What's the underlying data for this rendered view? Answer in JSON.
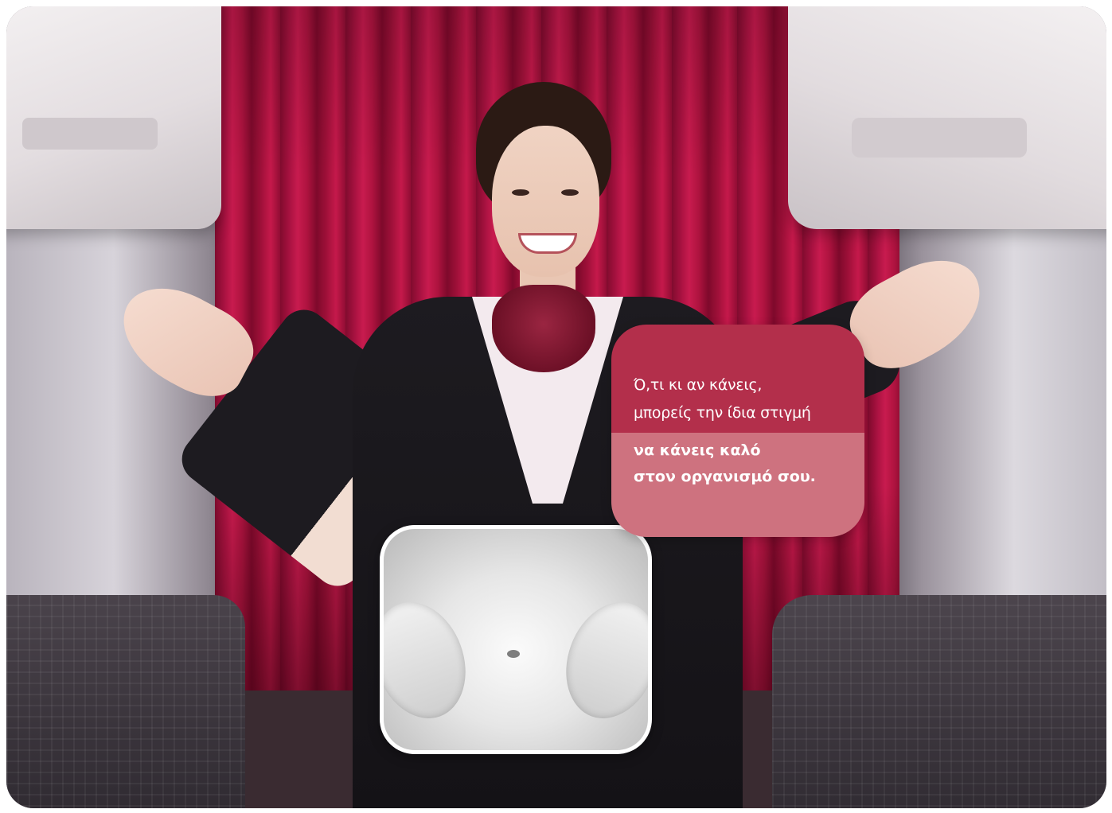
{
  "card": {
    "line1": "Ό,τι κι αν κάνεις,",
    "line2": "μπορείς την ίδια στιγμή",
    "line3": "να κάνεις καλό",
    "line4": "στον οργανισμό σου."
  },
  "colors": {
    "card_top": "#b32f4b",
    "card_bottom": "#ce727f",
    "curtain": "#a31440",
    "frame_border": "#ffffff"
  }
}
